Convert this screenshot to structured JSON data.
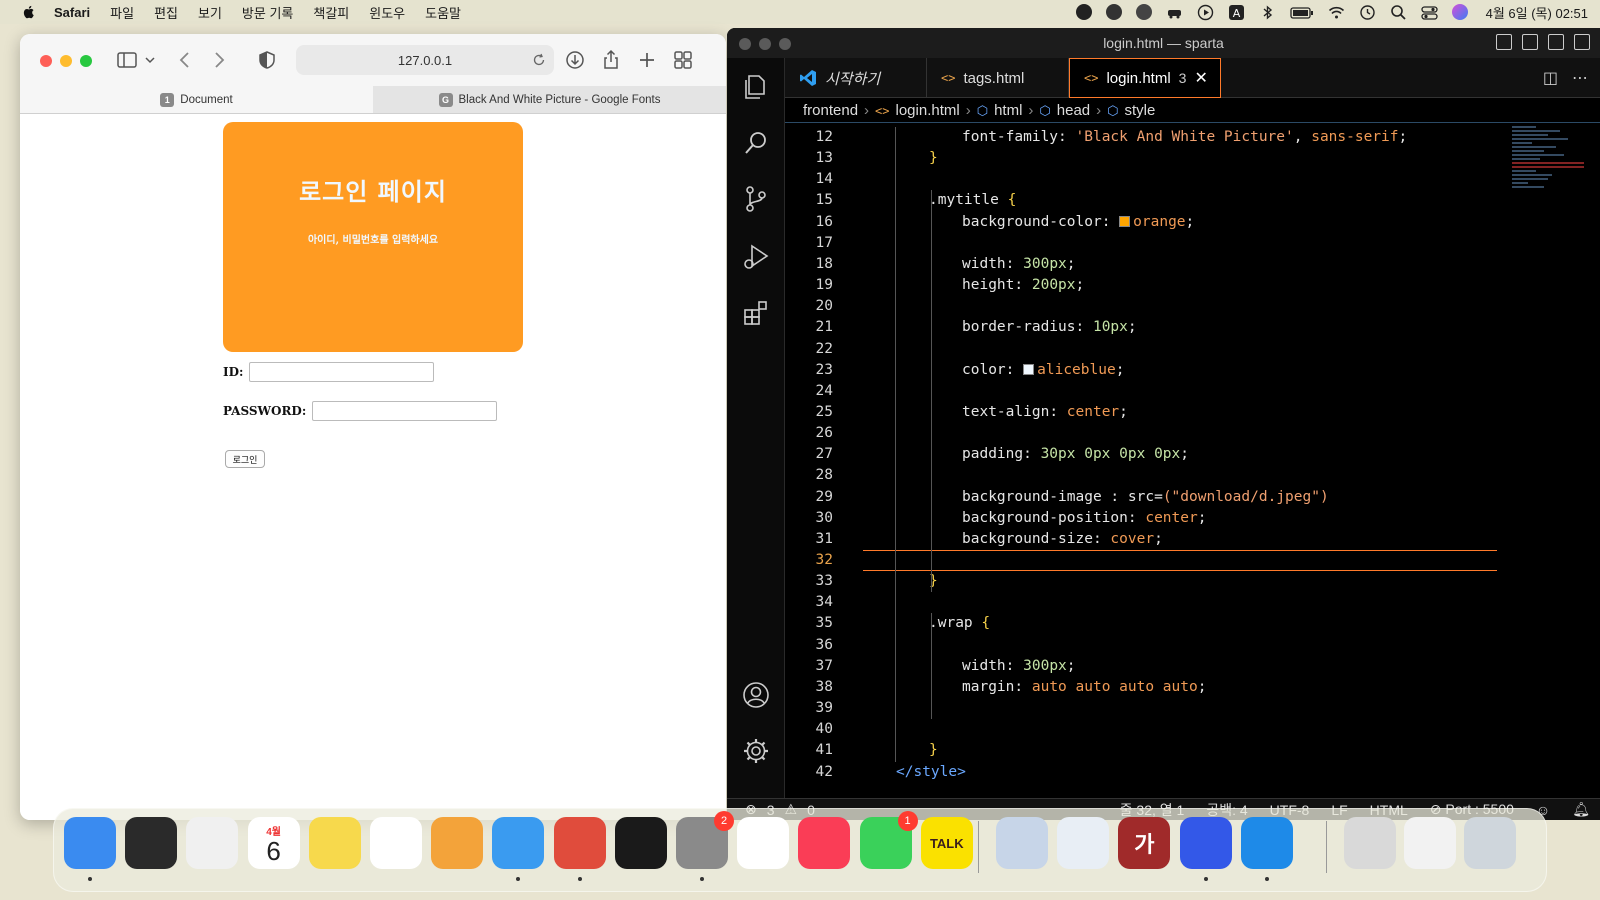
{
  "menubar": {
    "app": "Safari",
    "items": [
      "파일",
      "편집",
      "보기",
      "방문 기록",
      "책갈피",
      "윈도우",
      "도움말"
    ],
    "clock": "4월 6일 (목) 02:51"
  },
  "safari": {
    "address": "127.0.0.1",
    "tabs": [
      {
        "favicon": "1",
        "label": "Document"
      },
      {
        "favicon": "G",
        "label": "Black And White Picture - Google Fonts"
      }
    ],
    "page": {
      "title": "로그인 페이지",
      "subtitle": "아이디, 비밀번호를 입력하세요",
      "id_label": "ID:",
      "password_label": "PASSWORD:",
      "login_button": "로그인",
      "title_bg": "#ff9b22"
    }
  },
  "vscode": {
    "window_title": "login.html — sparta",
    "tabs": [
      {
        "label": "시작하기"
      },
      {
        "label": "tags.html"
      },
      {
        "label": "login.html",
        "badge": "3"
      }
    ],
    "breadcrumbs": [
      "frontend",
      "login.html",
      "html",
      "head",
      "style"
    ],
    "current_line": 32,
    "lines": [
      {
        "n": 12,
        "indent": 3,
        "html": "<span class='k-prop'>font-family</span>: <span class='k-str'>'Black And White Picture'</span>, <span class='k-val'>sans-serif</span>;"
      },
      {
        "n": 13,
        "indent": 2,
        "html": "<span class='k-brace'>}</span>"
      },
      {
        "n": 14,
        "indent": 0,
        "html": ""
      },
      {
        "n": 15,
        "indent": 2,
        "html": "<span class='k-sel'>.mytitle</span> <span class='k-brace'>{</span>"
      },
      {
        "n": 16,
        "indent": 3,
        "html": "<span class='k-prop'>background-color</span>: <span class='swatch' style='background:orange'></span><span class='k-val'>orange</span>;"
      },
      {
        "n": 17,
        "indent": 0,
        "html": ""
      },
      {
        "n": 18,
        "indent": 3,
        "html": "<span class='k-prop'>width</span>: <span class='k-num'>300px</span>;"
      },
      {
        "n": 19,
        "indent": 3,
        "html": "<span class='k-prop'>height</span>: <span class='k-num'>200px</span>;"
      },
      {
        "n": 20,
        "indent": 0,
        "html": ""
      },
      {
        "n": 21,
        "indent": 3,
        "html": "<span class='k-prop'>border-radius</span>: <span class='k-num'>10px</span>;"
      },
      {
        "n": 22,
        "indent": 0,
        "html": ""
      },
      {
        "n": 23,
        "indent": 3,
        "html": "<span class='k-prop'>color</span>: <span class='swatch' style='background:aliceblue'></span><span class='k-val'>aliceblue</span>;"
      },
      {
        "n": 24,
        "indent": 0,
        "html": ""
      },
      {
        "n": 25,
        "indent": 3,
        "html": "<span class='k-prop'>text-align</span>: <span class='k-val'>center</span>;"
      },
      {
        "n": 26,
        "indent": 0,
        "html": ""
      },
      {
        "n": 27,
        "indent": 3,
        "html": "<span class='k-prop'>padding</span>: <span class='k-num'>30px 0px 0px 0px</span>;"
      },
      {
        "n": 28,
        "indent": 0,
        "html": ""
      },
      {
        "n": 29,
        "indent": 3,
        "html": "<span class='k-prop'>background-image</span> : <span class='k-prop'>src</span>=<span class='k-str'>(\"download/d.jpeg\")</span>"
      },
      {
        "n": 30,
        "indent": 3,
        "html": "<span class='k-prop'>background-position</span>: <span class='k-val'>center</span>;"
      },
      {
        "n": 31,
        "indent": 3,
        "html": "<span class='k-prop'>background-size</span>: <span class='k-val'>cover</span>;"
      },
      {
        "n": 32,
        "indent": 0,
        "html": ""
      },
      {
        "n": 33,
        "indent": 2,
        "html": "<span class='k-brace'>}</span>"
      },
      {
        "n": 34,
        "indent": 0,
        "html": ""
      },
      {
        "n": 35,
        "indent": 2,
        "html": "<span class='k-sel'>.wrap</span> <span class='k-brace'>{</span>"
      },
      {
        "n": 36,
        "indent": 0,
        "html": ""
      },
      {
        "n": 37,
        "indent": 3,
        "html": "<span class='k-prop'>width</span>: <span class='k-num'>300px</span>;"
      },
      {
        "n": 38,
        "indent": 3,
        "html": "<span class='k-prop'>margin</span>: <span class='k-val'>auto auto auto auto</span>;"
      },
      {
        "n": 39,
        "indent": 0,
        "html": ""
      },
      {
        "n": 40,
        "indent": 0,
        "html": ""
      },
      {
        "n": 41,
        "indent": 2,
        "html": "<span class='k-brace'>}</span>"
      },
      {
        "n": 42,
        "indent": 1,
        "html": "<span class='k-tag'>&lt;/style&gt;</span>"
      }
    ],
    "status": {
      "errors": "3",
      "warnings": "0",
      "position": "줄 32, 열 1",
      "spaces": "공백: 4",
      "encoding": "UTF-8",
      "eol": "LF",
      "language": "HTML",
      "port": "Port : 5500"
    }
  },
  "dock": {
    "apps": [
      {
        "name": "finder",
        "label": "",
        "color": "#3a8bf0",
        "running": true
      },
      {
        "name": "launchpad-rocket",
        "label": "",
        "color": "#2a2a2a",
        "running": false
      },
      {
        "name": "launchpad",
        "label": "",
        "color": "#f0f0f0",
        "running": false
      },
      {
        "name": "calendar",
        "label": "6",
        "color": "#ffffff",
        "running": false
      },
      {
        "name": "notes",
        "label": "",
        "color": "#f7d94c",
        "running": false
      },
      {
        "name": "reminders",
        "label": "",
        "color": "#ffffff",
        "running": false
      },
      {
        "name": "photos",
        "label": "",
        "color": "#f3a33a",
        "running": false
      },
      {
        "name": "safari",
        "label": "",
        "color": "#3a9bf0",
        "running": true
      },
      {
        "name": "chrome",
        "label": "",
        "color": "#e04c3c",
        "running": true
      },
      {
        "name": "piano",
        "label": "",
        "color": "#1a1a1a",
        "running": false
      },
      {
        "name": "system-settings",
        "label": "",
        "color": "#8a8a8a",
        "badge": "2",
        "running": true
      },
      {
        "name": "linear",
        "label": "",
        "color": "#ffffff",
        "running": false
      },
      {
        "name": "music",
        "label": "",
        "color": "#fa3d56",
        "running": false
      },
      {
        "name": "messages",
        "label": "",
        "color": "#3ad15a",
        "badge": "1",
        "running": false
      },
      {
        "name": "kakaotalk",
        "label": "TALK",
        "color": "#fae100",
        "running": false
      },
      {
        "name": "preview",
        "label": "",
        "color": "#c7d5e8",
        "running": false
      },
      {
        "name": "textedit",
        "label": "",
        "color": "#e8eef5",
        "running": false
      },
      {
        "name": "dictionary",
        "label": "가",
        "color": "#a02a2a",
        "running": false
      },
      {
        "name": "figma-like",
        "label": "",
        "color": "#3358e8",
        "running": true
      },
      {
        "name": "vscode",
        "label": "",
        "color": "#1e8ae8",
        "running": true
      }
    ],
    "calendar_month": "4월"
  }
}
